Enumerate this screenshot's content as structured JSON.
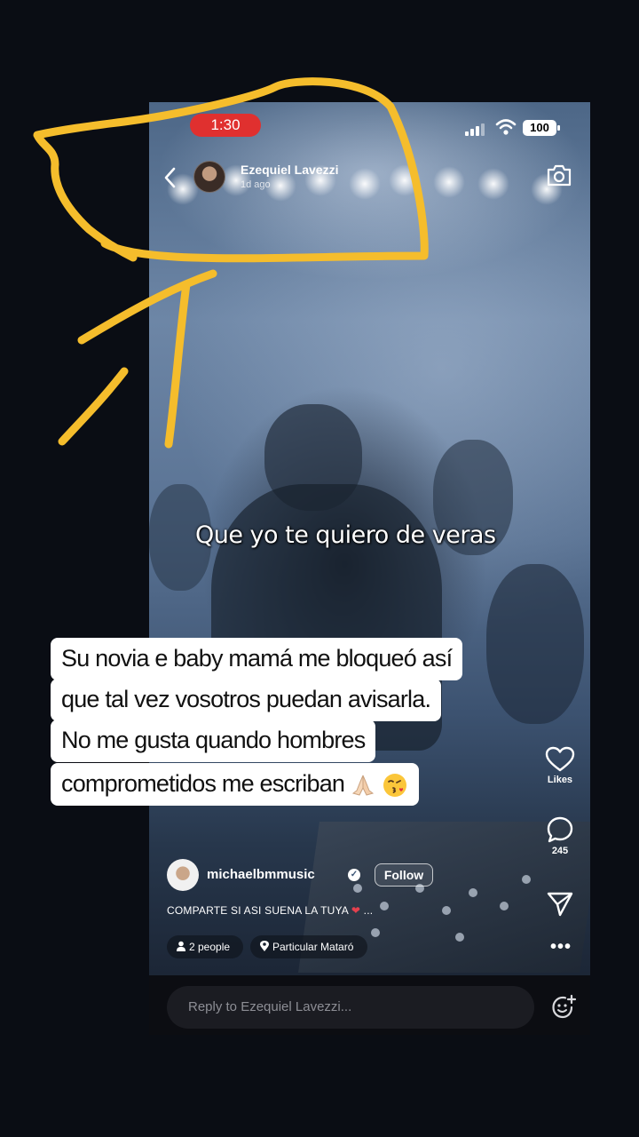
{
  "status_bar": {
    "time": "1:30",
    "battery": "100"
  },
  "story_header": {
    "author_name": "Ezequiel Lavezzi",
    "time_ago": "1d ago"
  },
  "video": {
    "caption": "Que yo te quiero de veras"
  },
  "side_actions": {
    "likes_label": "Likes",
    "comments_count": "245"
  },
  "creator": {
    "handle": "michaelbmmusic",
    "follow_label": "Follow",
    "description": "COMPARTE SI ASI SUENA LA TUYA",
    "description_suffix": "...",
    "people_chip": "2 people",
    "location_chip": "Particular Mataró"
  },
  "reply": {
    "placeholder": "Reply to Ezequiel Lavezzi..."
  },
  "overlay": {
    "lines": [
      "Su novia e baby mamá me bloqueó así",
      "que tal vez vosotros puedan avisarla.",
      "No me gusta quando hombres",
      "comprometidos me escriban"
    ]
  },
  "colors": {
    "annotation": "#f5bd2c",
    "time_pill": "#e0302f",
    "verified": "#3c5676"
  },
  "icons": [
    "back-chevron-icon",
    "camera-icon",
    "heart-icon",
    "comment-icon",
    "share-icon",
    "more-icon",
    "person-icon",
    "location-pin-icon",
    "emoji-sticker-icon",
    "wifi-icon",
    "signal-icon"
  ]
}
